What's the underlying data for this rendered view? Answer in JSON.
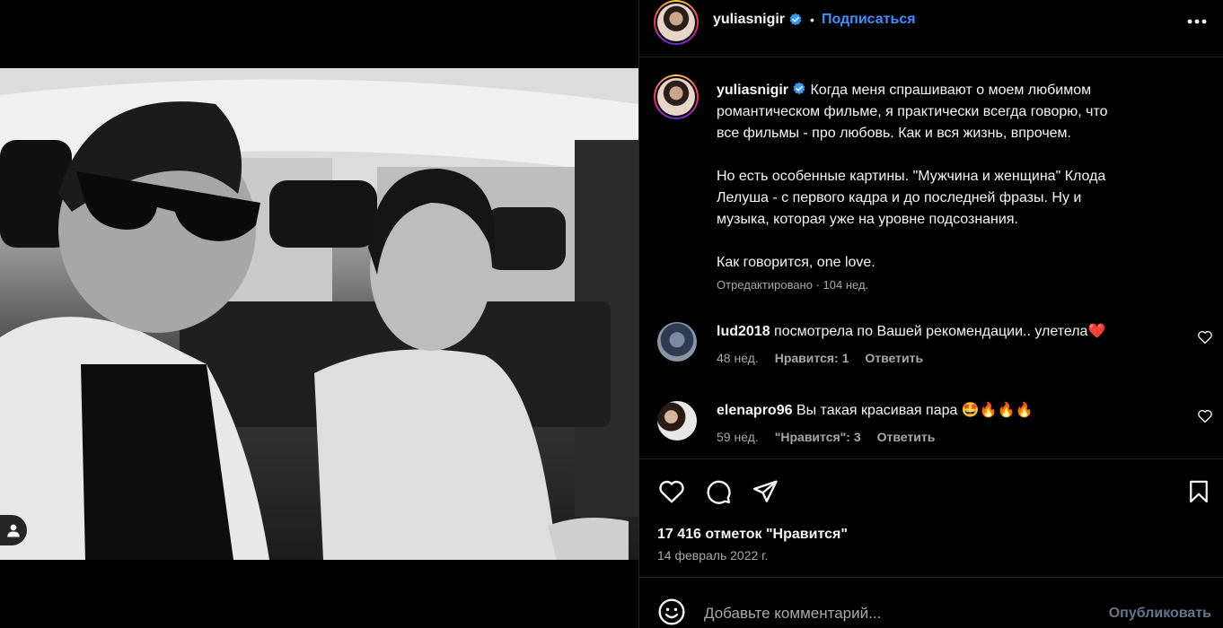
{
  "post": {
    "username": "yuliasnigir",
    "follow_label": "Подписаться",
    "dot": "•"
  },
  "caption": {
    "lines_p1": [
      "Когда меня спрашивают о моем любимом",
      "романтическом фильме, я практически всегда говорю, что",
      "все фильмы - про любовь. Как и вся жизнь, впрочем."
    ],
    "lines_p2": [
      "Но есть особенные картины. \"Мужчина и женщина\" Клода",
      "Лелуша - с первого кадра и до последней фразы. Ну и",
      "музыка, которая уже на уровне подсознания."
    ],
    "line_p3": "Как говорится, one love.",
    "meta": "Отредактировано · 104 нед."
  },
  "comments": [
    {
      "username": "lud2018",
      "text": "посмотрела по Вашей рекомендации.. улетела",
      "emoji": "❤️",
      "age": "48 нед.",
      "likes": "Нравится: 1",
      "reply": "Ответить"
    },
    {
      "username": "elenapro96",
      "text": "Вы такая красивая пара",
      "emoji": "🤩🔥🔥🔥",
      "age": "59 нед.",
      "likes": "\"Нравится\": 3",
      "reply": "Ответить"
    }
  ],
  "stats": {
    "likes": "17 416 отметок \"Нравится\"",
    "date": "14 февраль 2022 г."
  },
  "add_comment": {
    "placeholder": "Добавьте комментарий...",
    "publish_label": "Опубликовать"
  },
  "icons": {
    "more": "more-horizontal-icon",
    "like": "heart-icon",
    "comment": "comment-icon",
    "share": "paper-plane-icon",
    "save": "bookmark-icon",
    "emoji": "smiley-icon",
    "verified": "verified-badge-icon",
    "user_tag": "user-icon"
  },
  "colors": {
    "background": "#000000",
    "text": "#f5f5f5",
    "secondary": "#a8a8a8",
    "link": "#3b8fff",
    "verified": "#3897f0",
    "divider": "#262626",
    "publish_disabled": "#67758a"
  }
}
